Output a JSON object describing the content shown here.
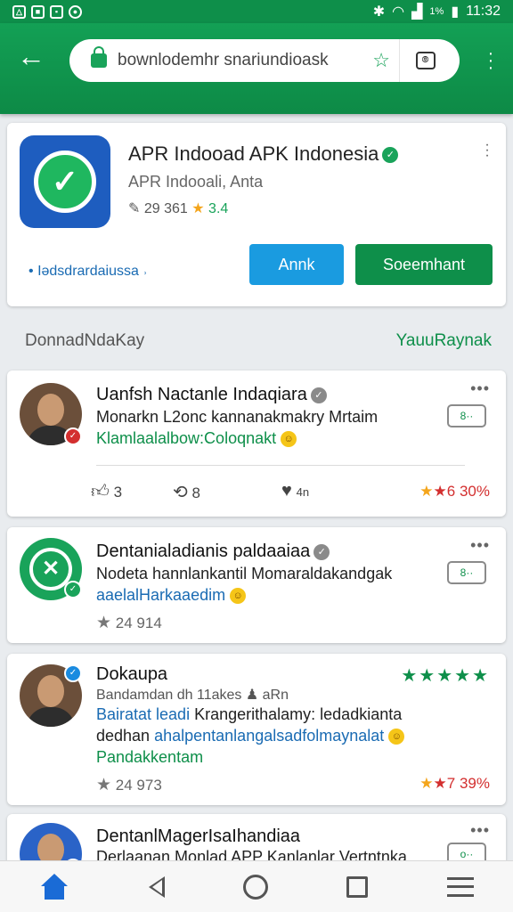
{
  "status": {
    "time": "11:32",
    "battery": "1%"
  },
  "browser": {
    "url": "bownlodemhr snariundioask"
  },
  "app": {
    "name": "APR Indoоad APK Indonesia",
    "developer": "APR Indooali, Anta",
    "downloads": "29 361",
    "rating": "3.4",
    "link": "Iədsdrardaiussa",
    "btn_primary": "Annk",
    "btn_secondary": "Soeemhant"
  },
  "section": {
    "left": "DonnadNdaKay",
    "right": "YauuRaynak"
  },
  "reviews": [
    {
      "name": "Uanfsh Nactanle Indaqiara",
      "line1": "Monarkn L2onc kannanakmakry Mrtaim",
      "line2": "Klamlaalalbow:Coloqnakt",
      "likes": "3",
      "shares": "8",
      "hearts": "4n",
      "score": "6 30%"
    },
    {
      "name": "Dentanialadianis paldaaiaa",
      "line1": "Nodeta hannlankantil Momaraldakandgak",
      "line2": "aaelalHarkaaedim",
      "rating": "24 914"
    },
    {
      "name": "Dokaupa",
      "meta": "Bandamdan dh 11akes",
      "meta2": "aRn",
      "line1a": "Bairatat leadi",
      "line1b": "Krangerithalamy: ledadkianta",
      "line2a": "dedhan",
      "line2b": "ahalpentanlangalsadfolmaynalat",
      "line3": "Pandakkentam",
      "rating": "24 973",
      "score": "7 39%"
    },
    {
      "name": "DentanlMagerIsaIhandiaa",
      "line1": "Derlaanan Monlad APP Kanlanlar Vertntnka"
    }
  ]
}
